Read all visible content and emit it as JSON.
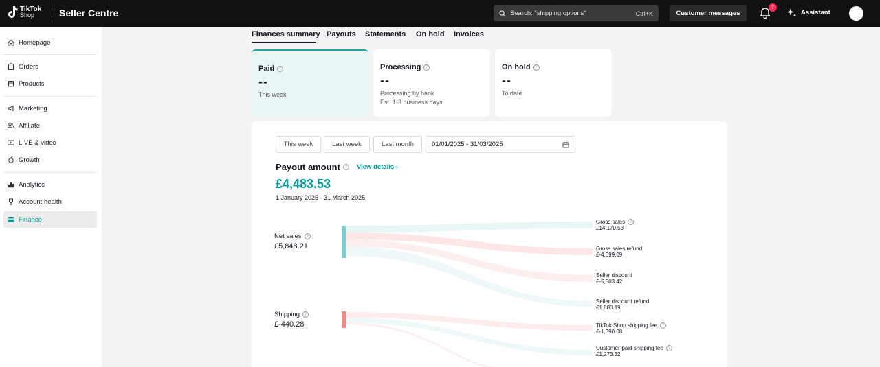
{
  "header": {
    "logo_line1": "TikTok",
    "logo_line2": "Shop",
    "title": "Seller Centre",
    "search_placeholder": "Search: \"shipping options\"",
    "search_shortcut": "Ctrl+K",
    "customer_messages": "Customer messages",
    "notification_count": "7",
    "assistant": "Assistant"
  },
  "sidebar": {
    "items": [
      {
        "label": "Homepage",
        "icon": "home-icon"
      },
      {
        "label": "Orders",
        "icon": "clipboard-icon"
      },
      {
        "label": "Products",
        "icon": "box-icon"
      },
      {
        "label": "Marketing",
        "icon": "megaphone-icon"
      },
      {
        "label": "Affiliate",
        "icon": "people-icon"
      },
      {
        "label": "LIVE & video",
        "icon": "video-icon"
      },
      {
        "label": "Growth",
        "icon": "growth-icon"
      },
      {
        "label": "Analytics",
        "icon": "bar-chart-icon"
      },
      {
        "label": "Account health",
        "icon": "trophy-icon"
      },
      {
        "label": "Finance",
        "icon": "wallet-icon"
      }
    ],
    "active": "Finance"
  },
  "tabs": [
    "Finances summary",
    "Payouts",
    "Statements",
    "On hold",
    "Invoices"
  ],
  "cards": [
    {
      "title": "Paid",
      "value": "--",
      "sub1": "This week",
      "sub2": ""
    },
    {
      "title": "Processing",
      "value": "--",
      "sub1": "Processing by bank",
      "sub2": "Est. 1-3 business days"
    },
    {
      "title": "On hold",
      "value": "--",
      "sub1": "To date",
      "sub2": ""
    }
  ],
  "filters": {
    "this_week": "This week",
    "last_week": "Last week",
    "last_month": "Last month",
    "date_range": "01/01/2025 - 31/03/2025"
  },
  "payout": {
    "title": "Payout amount",
    "view_details": "View details",
    "amount": "£4,483.53",
    "range": "1 January 2025 - 31 March 2025"
  },
  "sankey": {
    "sources": [
      {
        "label": "Net sales",
        "value": "£5,848.21",
        "color": "#7ecfcf"
      },
      {
        "label": "Shipping",
        "value": "£-440.28",
        "color": "#f08a8a"
      }
    ],
    "targets": [
      {
        "label": "Gross sales",
        "value": "£14,170.53",
        "help": true
      },
      {
        "label": "Gross sales refund",
        "value": "£-4,699.09",
        "help": false
      },
      {
        "label": "Seller discount",
        "value": "£-5,503.42",
        "help": false
      },
      {
        "label": "Seller discount refund",
        "value": "£1,880.19",
        "help": false
      },
      {
        "label": "TikTok Shop shipping fee",
        "value": "£-1,390.08",
        "help": true
      },
      {
        "label": "Customer-paid shipping fee",
        "value": "£1,273.32",
        "help": true
      }
    ]
  },
  "colors": {
    "accent": "#009995",
    "topbar": "#121212",
    "badge": "#fe2c55"
  }
}
